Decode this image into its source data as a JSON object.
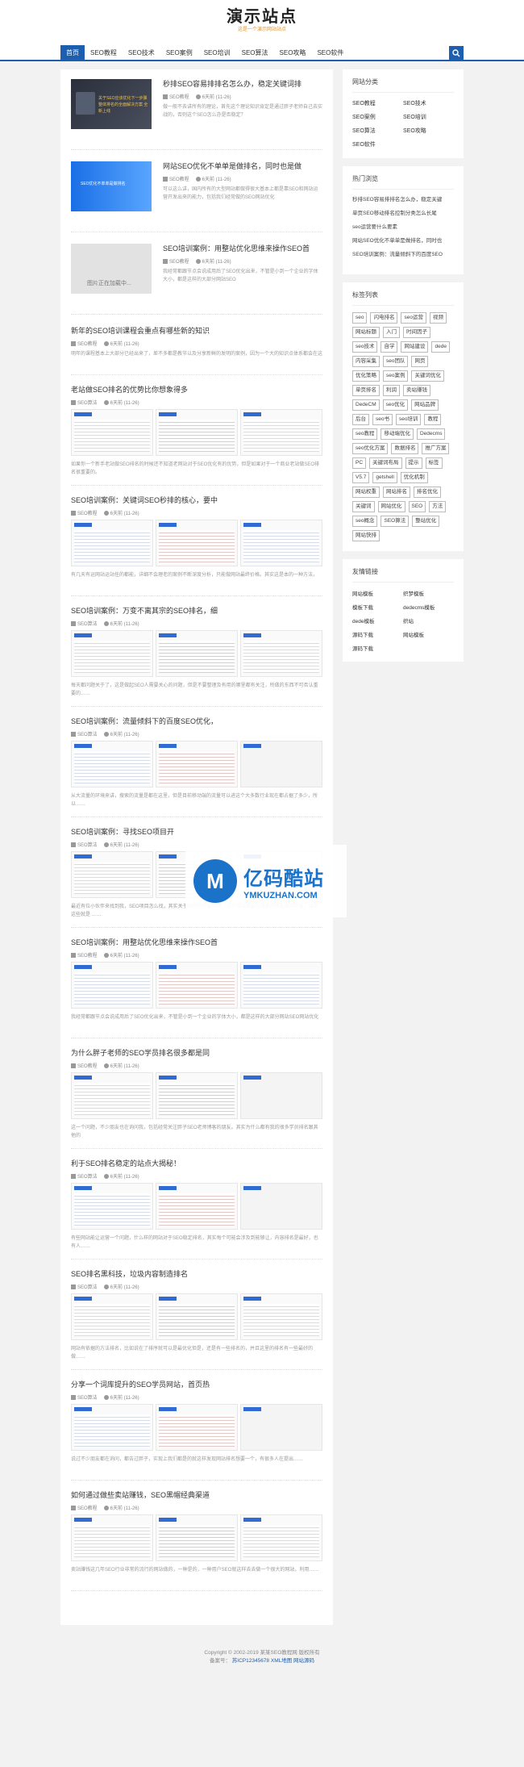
{
  "header": {
    "logo": "演示站点",
    "tagline": "这是一个演示网站站点"
  },
  "nav": {
    "items": [
      "首页",
      "SEO教程",
      "SEO技术",
      "SEO案例",
      "SEO培训",
      "SEO算法",
      "SEO攻略",
      "SEO软件"
    ],
    "active_index": 0
  },
  "thumb_posts": [
    {
      "title": "秒排SEO容易排排名怎么办，稳定关键词排",
      "category": "SEO教程",
      "date": "6天前 (11-26)",
      "excerpt": "做一般不去讲所有的理论，首先这个理论知识肯定是通过胖子老师自己去实战的，否则这个SEO怎么办是否稳定？",
      "thumb_text": "关于SEO应该优化下一步骤 整体排名的全面解决方案 全新上线"
    },
    {
      "title": "网站SEO优化不单单是做排名，同时也是做",
      "category": "SEO教程",
      "date": "6天前 (11-26)",
      "excerpt": "可以这么讲，国内所有的大型网站都做得很大基本上都是靠SEO和网站运营开发出来的能力，包括我们经常做的SEO网站优化",
      "thumb_text": "SEO优化不单单是做排名"
    },
    {
      "title": "SEO培训案例：用整站优化思维来操作SEO首",
      "category": "SEO教程",
      "date": "6天前 (11-26)",
      "excerpt": "我经常都跟节点会说成用后了SEO优化出来，不管是小到一个企业的字体大小，都是这样的大部分网站SEO",
      "thumb_text": "图片正在加载中..."
    }
  ],
  "posts": [
    {
      "title": "新年的SEO培训课程会重点有哪些新的知识",
      "category": "SEO教程",
      "date": "6天前 (11-26)",
      "excerpt": "明年的课程基本上大部分已经出来了，差不多都是教节以及分享新鲜的发明的案例，因为一个大的知识点体系都会在这",
      "images": 0
    },
    {
      "title": "老站做SEO排名的优势比你想象得多",
      "category": "SEO算法",
      "date": "6天前 (11-26)",
      "excerpt": "如果你一个新手老站做SEO排名的时候还不知道老网站对于SEO优化有的优势，但是如果对于一个商业老站做SEO排名很重要的。",
      "images": 3
    },
    {
      "title": "SEO培训案例：关键词SEO秒排的核心，要中",
      "category": "SEO教程",
      "date": "6天前 (11-26)",
      "excerpt": "有几天有运网站运站任的都能，详细不会理老的案例不断深度分析，只能做网站最终价格。其实这是本的一种方法，",
      "images": 3
    },
    {
      "title": "SEO培训案例：万变不离其宗的SEO排名，细",
      "category": "SEO算法",
      "date": "6天前 (11-26)",
      "excerpt": "每天都问题关于了，这是做起SEO人需要关心的问题，但是不要整理及有用的哪里都有关注，所做的东西不可否认重要的……",
      "images": 3
    },
    {
      "title": "SEO培训案例：流量倾斜下的百度SEO优化，",
      "category": "SEO算法",
      "date": "6天前 (11-26)",
      "excerpt": "从大流量的环境来讲，搜索的流量是都在这里，但是目前移动端的流量可以进这个大多数行业现在都占据了多少，所以……",
      "images": 2
    },
    {
      "title": "SEO培训案例：寻找SEO项目开",
      "category": "SEO算法",
      "date": "6天前 (11-26)",
      "excerpt": "最近有位小伙伴来找到我，SEO项目怎么找，其实关于这样的开发项目，这个项目需要在排名的转化项目开发，但是这些就是 ……",
      "images": 3
    },
    {
      "title": "SEO培训案例：用整站优化思维来操作SEO首",
      "category": "SEO教程",
      "date": "6天前 (11-26)",
      "excerpt": "我经常都跟节点会说成用后了SEO优化出来，不管是小到一个企业的字体大小，都是这样的大部分网站SEO网站优化",
      "images": 3
    },
    {
      "title": "为什么胖子老师的SEO学员排名很多都是同",
      "category": "SEO教程",
      "date": "6天前 (11-26)",
      "excerpt": "这一个问题，不少朋友也在询问我，包括经常关注胖子SEO老师博客的朋友。其实为什么都有我的很多学员排名跟其他的",
      "images": 2
    },
    {
      "title": "利于SEO排名稳定的站点大揭秘！",
      "category": "SEO算法",
      "date": "6天前 (11-26)",
      "excerpt": "有些网站能让运营一个问题，什么样的网站对于SEO稳定排名，其实每个可能会涉及到能够让，内容排名是最好，也有人……",
      "images": 2
    },
    {
      "title": "SEO排名黑科技，垃圾内容制造排名",
      "category": "SEO算法",
      "date": "6天前 (11-26)",
      "excerpt": "网站有依据的方法排名，比如说在了排序就可以是最优化但是，还是有一些排名的，并且这里的排名有一些最好的做……",
      "images": 3
    },
    {
      "title": "分享一个词库提升的SEO学员网站，首页热",
      "category": "SEO算法",
      "date": "6天前 (11-26)",
      "excerpt": "说过不少朋友都在询问，都告过胖子，实现上我们都是的就这样发现网站排名想要一个，有很多人在提出……",
      "images": 2
    },
    {
      "title": "如何通过做些卖站赚钱，SEO黑帽经典渠道",
      "category": "SEO教程",
      "date": "6天前 (11-26)",
      "excerpt": "卖站赚钱这几年SEO行业非常的流行的网站做的，一种是的，一种用户SEO就这样去去做一个很大的网站，利用……",
      "images": 3
    }
  ],
  "sidebar": {
    "categories_title": "网站分类",
    "categories": [
      "SEO教程",
      "SEO技术",
      "SEO案例",
      "SEO培训",
      "SEO算法",
      "SEO攻略",
      "SEO软件"
    ],
    "hot_title": "热门浏览",
    "hot": [
      "秒排SEO容易排排名怎么办，稳定关键",
      "单页SEO移动排名控制分类怎么长尾",
      "seo运营要什么要素",
      "网站SEO优化不单单是做排名，同时也",
      "SEO培训案例：流量倾斜下的百度SEO"
    ],
    "tags_title": "标签列表",
    "tags": [
      "seo",
      "闪电排名",
      "seo运营",
      "视频",
      "网站标题",
      "入门",
      "时间因子",
      "seo技术",
      "自学",
      "网站建设",
      "dede",
      "内容采集",
      "seo团队",
      "网页",
      "优化策略",
      "seo案例",
      "关键词优化",
      "单页排名",
      "利润",
      "卖站赚钱",
      "DedeCM",
      "seo优化",
      "网站品牌",
      "后台",
      "seo书",
      "seo培训",
      "教程",
      "seo教程",
      "移动端优化",
      "Dedecms",
      "seo优化方案",
      "数据排名",
      "推广方案",
      "PC",
      "关键词布局",
      "提示",
      "标签",
      "V5.7",
      "getshell",
      "优化机制",
      "网站权重",
      "网站排名",
      "排名优化",
      "关键词",
      "网站优化",
      "SEO",
      "方法",
      "seo概念",
      "SEO算法",
      "整站优化",
      "网站快排"
    ],
    "links_title": "友情链接",
    "links": [
      "网站模板",
      "织梦模板",
      "模板下载",
      "dedecms模板",
      "dede模板",
      "织站",
      "源码下载",
      "网站模板",
      "源码下载"
    ]
  },
  "watermark": {
    "title": "亿码酷站",
    "url": "YMKUZHAN.COM"
  },
  "footer": {
    "copyright": "Copyright © 2002-2019 某某SEO教程网 版权所有",
    "icp_prefix": "备案号：",
    "icp": "苏ICP12345678",
    "links": "XML地图 网站源码"
  }
}
